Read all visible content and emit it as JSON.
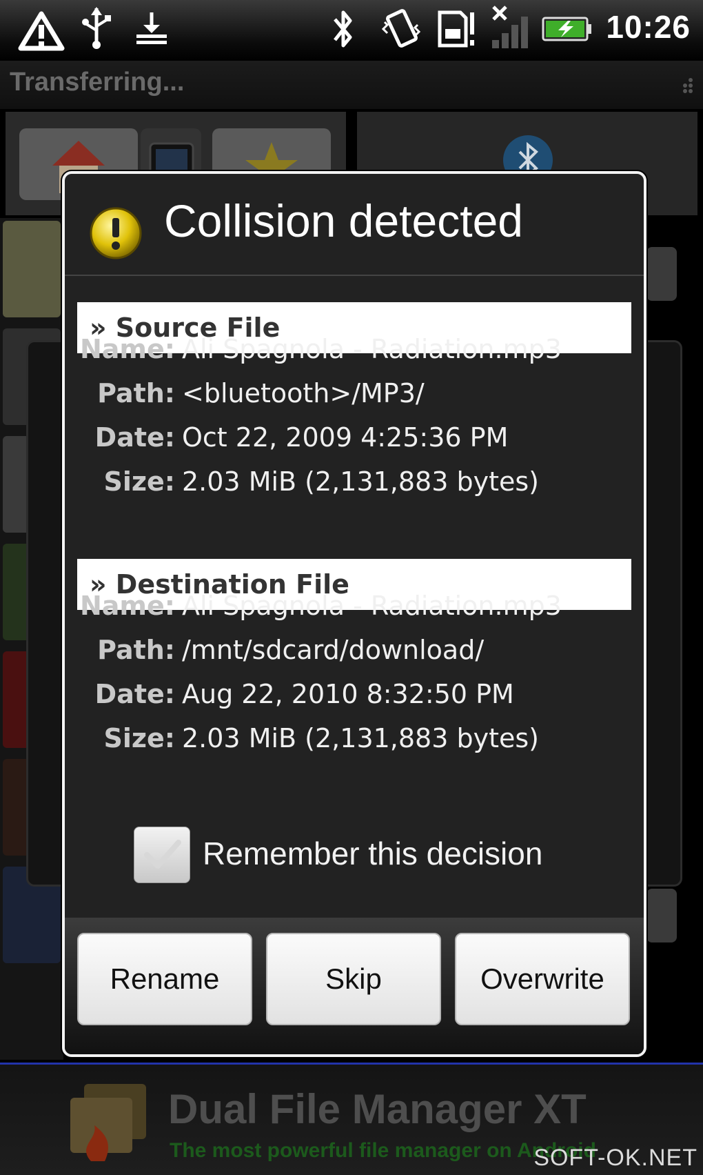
{
  "status_bar": {
    "time": "10:26",
    "icons": [
      "warning-icon",
      "usb-icon",
      "download-icon",
      "bluetooth-icon",
      "vibrate-icon",
      "sd-card-alert-icon",
      "no-signal-icon",
      "battery-charging-icon"
    ]
  },
  "app": {
    "title": "Transferring..."
  },
  "dialog": {
    "title": "Collision detected",
    "icon": "warning-icon",
    "source": {
      "header": "» Source File",
      "name_label": "Name:",
      "name": "Ali Spagnola - Radiation.mp3",
      "path_label": "Path:",
      "path": "<bluetooth>/MP3/",
      "date_label": "Date:",
      "date": "Oct 22, 2009 4:25:36 PM",
      "size_label": "Size:",
      "size": "2.03 MiB (2,131,883 bytes)"
    },
    "destination": {
      "header": "» Destination File",
      "name_label": "Name:",
      "name": "Ali Spagnola - Radiation.mp3",
      "path_label": "Path:",
      "path": "/mnt/sdcard/download/",
      "date_label": "Date:",
      "date": "Aug 22, 2010 8:32:50 PM",
      "size_label": "Size:",
      "size": "2.03 MiB (2,131,883 bytes)"
    },
    "remember_label": "Remember this decision",
    "remember_checked": false,
    "buttons": {
      "rename": "Rename",
      "skip": "Skip",
      "overwrite": "Overwrite"
    }
  },
  "banner": {
    "title": "Dual File Manager XT",
    "tagline": "The most powerful file manager on Android",
    "watermark": "SOFT-OK.NET"
  },
  "colors": {
    "dialog_bg": "#222222",
    "section_header_bg": "#ffffff",
    "button_bg": "#f0f0f0",
    "banner_accent": "#2233aa"
  }
}
